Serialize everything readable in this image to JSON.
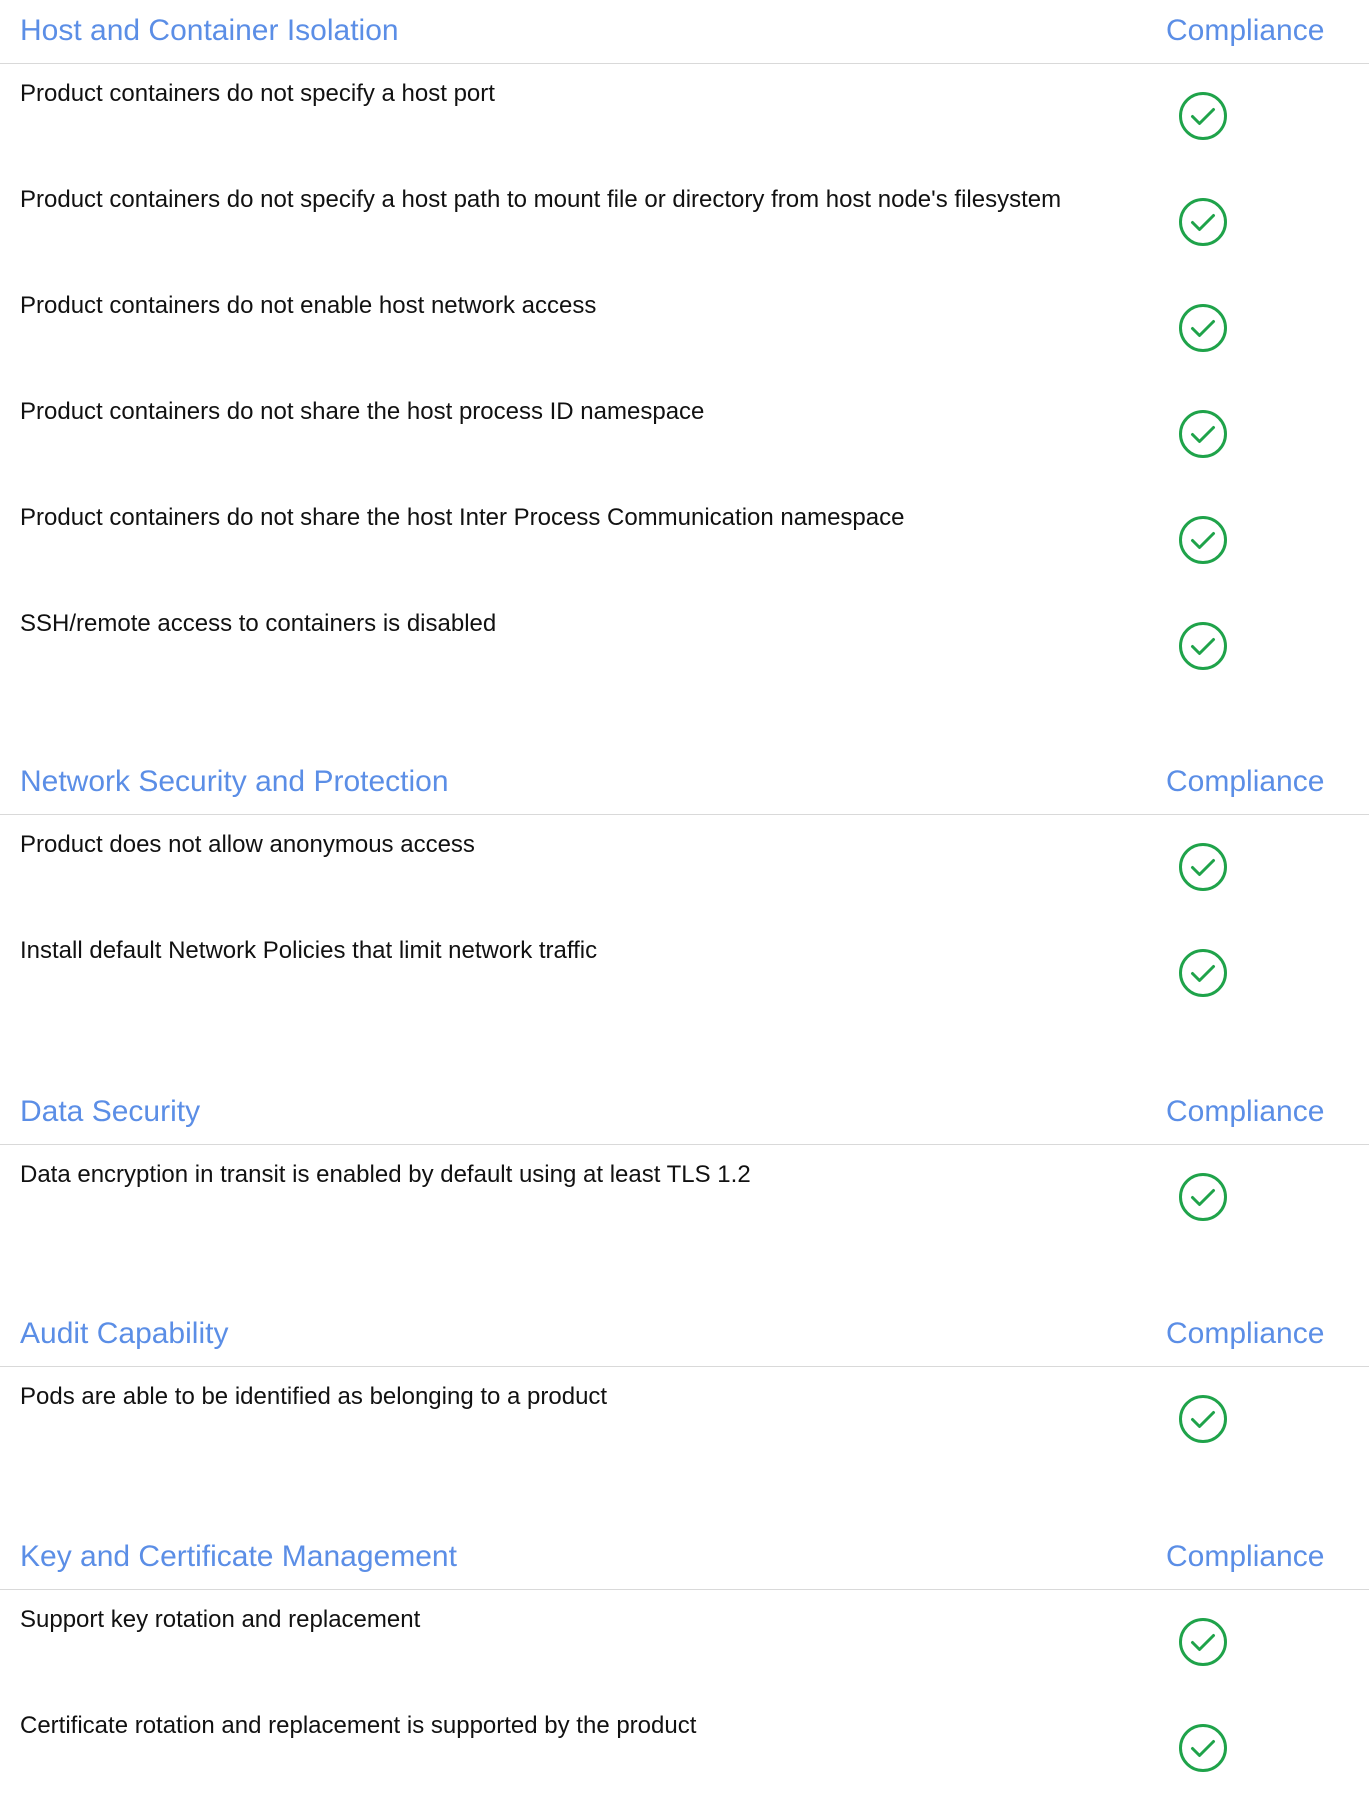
{
  "colors": {
    "heading": "#5b8ee6",
    "check": "#1fa34a",
    "divider": "#d9d9d9"
  },
  "sections": [
    {
      "title": "Host and Container Isolation",
      "compliance_label": "Compliance",
      "items": [
        {
          "text": "Product containers do not specify a host port",
          "status_icon": "check-circle-icon"
        },
        {
          "text": "Product containers do not specify a host path to mount file or directory from host node's filesystem",
          "status_icon": "check-circle-icon"
        },
        {
          "text": "Product containers do not enable host network access",
          "status_icon": "check-circle-icon"
        },
        {
          "text": "Product containers do not share the host process ID namespace",
          "status_icon": "check-circle-icon"
        },
        {
          "text": "Product containers do not share the host Inter Process Communication namespace",
          "status_icon": "check-circle-icon"
        },
        {
          "text": "SSH/remote access to containers is disabled",
          "status_icon": "check-circle-icon"
        }
      ]
    },
    {
      "title": "Network Security and Protection",
      "compliance_label": "Compliance",
      "items": [
        {
          "text": "Product does not allow anonymous access",
          "status_icon": "check-circle-icon"
        },
        {
          "text": "Install default Network Policies that limit network traffic",
          "status_icon": "check-circle-icon"
        }
      ]
    },
    {
      "title": "Data Security",
      "compliance_label": "Compliance",
      "items": [
        {
          "text": "Data encryption in transit is enabled by default using at least TLS 1.2",
          "status_icon": "check-circle-icon"
        }
      ]
    },
    {
      "title": "Audit Capability",
      "compliance_label": "Compliance",
      "items": [
        {
          "text": "Pods are able to be identified as belonging to a product",
          "status_icon": "check-circle-icon"
        }
      ]
    },
    {
      "title": "Key and Certificate Management",
      "compliance_label": "Compliance",
      "items": [
        {
          "text": "Support key rotation and replacement",
          "status_icon": "check-circle-icon"
        },
        {
          "text": "Certificate rotation and replacement is supported by the product",
          "status_icon": "check-circle-icon"
        }
      ]
    }
  ]
}
